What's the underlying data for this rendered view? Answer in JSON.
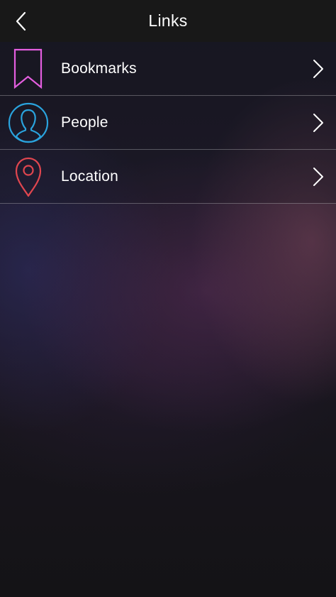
{
  "nav": {
    "title": "Links",
    "back_icon": "chevron-left-icon"
  },
  "links": [
    {
      "label": "Bookmarks",
      "icon": "bookmark-icon",
      "color": "#e45ee0"
    },
    {
      "label": "People",
      "icon": "person-icon",
      "color": "#2aa3dd"
    },
    {
      "label": "Location",
      "icon": "location-pin-icon",
      "color": "#e0464f"
    }
  ],
  "colors": {
    "nav_background": "#181818",
    "text": "#ffffff",
    "divider": "rgba(255,255,255,0.28)"
  }
}
